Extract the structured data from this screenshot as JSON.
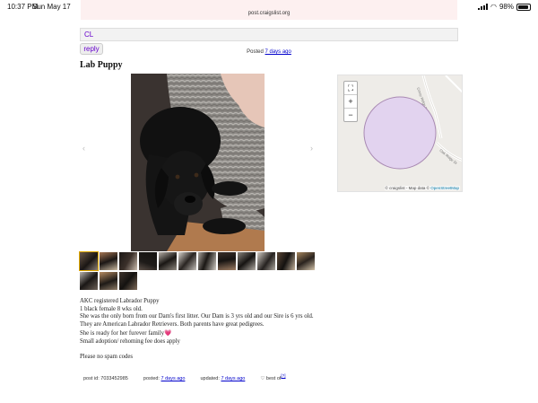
{
  "status_bar": {
    "time": "10:37 PM",
    "date": "Sun May 17",
    "battery": "98%"
  },
  "browser": {
    "url": "post.craigslist.org"
  },
  "header": {
    "logo": "CL"
  },
  "actions": {
    "reply_label": "reply"
  },
  "posting": {
    "posted_label": "Posted",
    "posted_ago": "7 days ago",
    "title": "Lab Puppy"
  },
  "gallery": {
    "prev_arrow": "‹",
    "next_arrow": "›",
    "thumbnail_count": 15
  },
  "map": {
    "zoom_in": "+",
    "zoom_out": "−",
    "attribution_prefix": "© craigslist - Map data ©",
    "attribution_link": "OpenStreetMap",
    "circle_color": "#e2d3ef"
  },
  "description": {
    "line1": "AKC registered Labrador Puppy",
    "line2": "1 black female 8 wks old.",
    "line3": "She was the only born from our Dam's first litter. Our Dam is 3 yrs old and our Sire is 6 yrs old.",
    "line4": "They are American Labrador Retrievers. Both parents have great pedigrees.",
    "line5": "She is ready for her furever family",
    "line6": "Small adoption/ rehoming fee does apply",
    "line7": "Please no spam codes"
  },
  "footer": {
    "post_id_label": "post id: 7033452985",
    "posted_label": "posted:",
    "posted_value": "7 days ago",
    "updated_label": "updated:",
    "updated_value": "7 days ago",
    "best_of_label": "best of",
    "best_of_sup": "[?]"
  },
  "colors": {
    "link": "#0000cc",
    "craigslist_purple": "#6600cc"
  }
}
